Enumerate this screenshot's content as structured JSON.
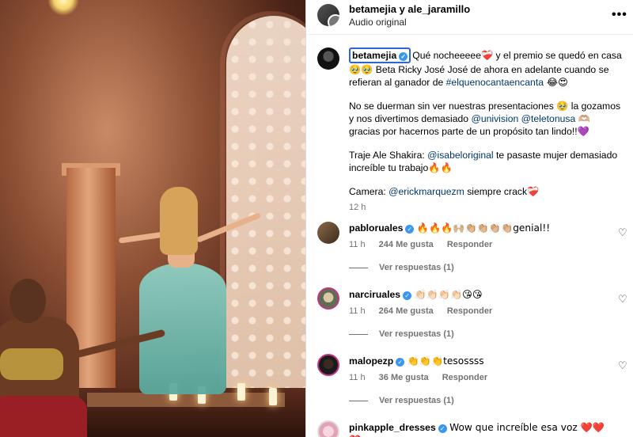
{
  "header": {
    "title": "betamejia y ale_jaramillo",
    "audio": "Audio original",
    "more_icon": "more-horizontal-icon"
  },
  "caption": {
    "username": "betamejia",
    "p1_text1": "Qué nocheeeee",
    "p1_emoji1": "❤️‍🩹",
    "p1_text2": " y el premio se quedó en casa ",
    "p1_emoji2": "🥹🥹",
    "p1_text3": " Beta Ricky José José de ahora en adelante cuando se refieran al ganador de ",
    "p1_hashtag": "#elquenocantaencanta",
    "p1_emoji3": " 😂😍",
    "p2_text1": "No se duerman sin ver nuestras presentaciones ",
    "p2_emoji1": "🥹",
    "p2_text2": " la gozamos y nos divertimos demasiado ",
    "p2_mention1": "@univision",
    "p2_mention2": "@teletonusa",
    "p2_emoji2": "🫶🏼",
    "p2_text3": " gracias por hacernos parte de un propósito tan lindo!!",
    "p2_emoji3": "💜",
    "p3_text1": "Traje Ale Shakira: ",
    "p3_mention": "@isabeloriginal",
    "p3_text2": " te pasaste mujer demasiado increíble tu trabajo",
    "p3_emoji": "🔥🔥",
    "p4_text1": "Camera: ",
    "p4_mention": "@erickmarquezm",
    "p4_text2": " siempre crack",
    "p4_emoji": "❤️‍🩹",
    "time": "12 h"
  },
  "comments": [
    {
      "username": "pabloruales",
      "text": "🔥🔥🔥🙌🏼👏🏼👏🏼👏🏼👏🏼genial!!",
      "time": "11 h",
      "likes": "244 Me gusta",
      "reply": "Responder",
      "view_replies": "Ver respuestas (1)"
    },
    {
      "username": "narciruales",
      "text": "👏🏻👏🏻👏🏻👏🏻😘😘",
      "time": "11 h",
      "likes": "264 Me gusta",
      "reply": "Responder",
      "view_replies": "Ver respuestas (1)"
    },
    {
      "username": "malopezp",
      "text": "👏👏👏tesossss",
      "time": "11 h",
      "likes": "36 Me gusta",
      "reply": "Responder",
      "view_replies": "Ver respuestas (1)"
    },
    {
      "username": "pinkapple_dresses",
      "text": "Wow que increíble esa voz ❤️❤️❤️"
    }
  ],
  "icons": {
    "verified": "verified-badge-icon",
    "heart": "heart-outline-icon"
  },
  "colors": {
    "link": "#00376b",
    "verified": "#3897f0",
    "muted": "#737373",
    "focus_outline": "#2d67d6"
  }
}
